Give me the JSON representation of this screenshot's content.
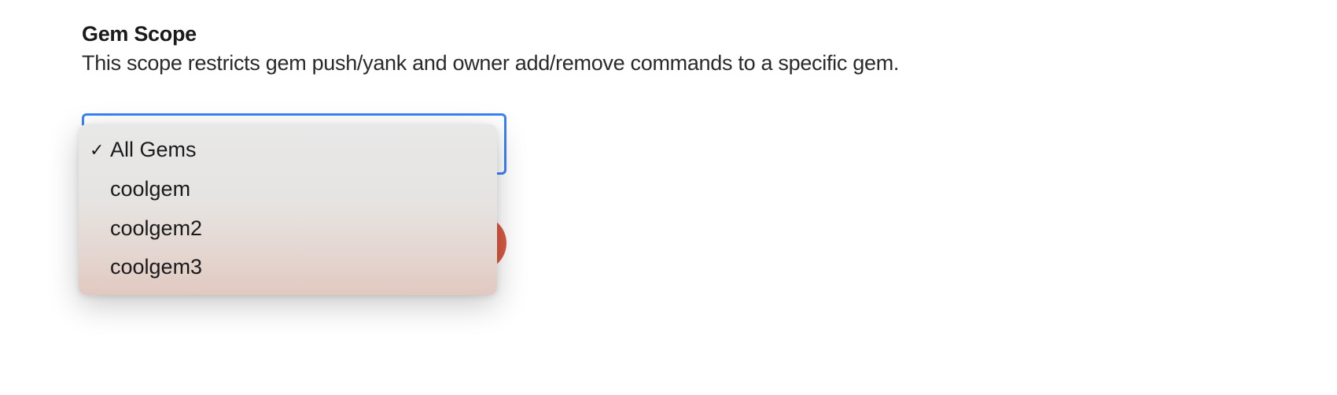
{
  "section": {
    "title": "Gem Scope",
    "description": "This scope restricts gem push/yank and owner add/remove commands to a specific gem."
  },
  "dropdown": {
    "options": [
      {
        "label": "All Gems",
        "selected": true
      },
      {
        "label": "coolgem",
        "selected": false
      },
      {
        "label": "coolgem2",
        "selected": false
      },
      {
        "label": "coolgem3",
        "selected": false
      }
    ],
    "checkmark": "✓"
  }
}
